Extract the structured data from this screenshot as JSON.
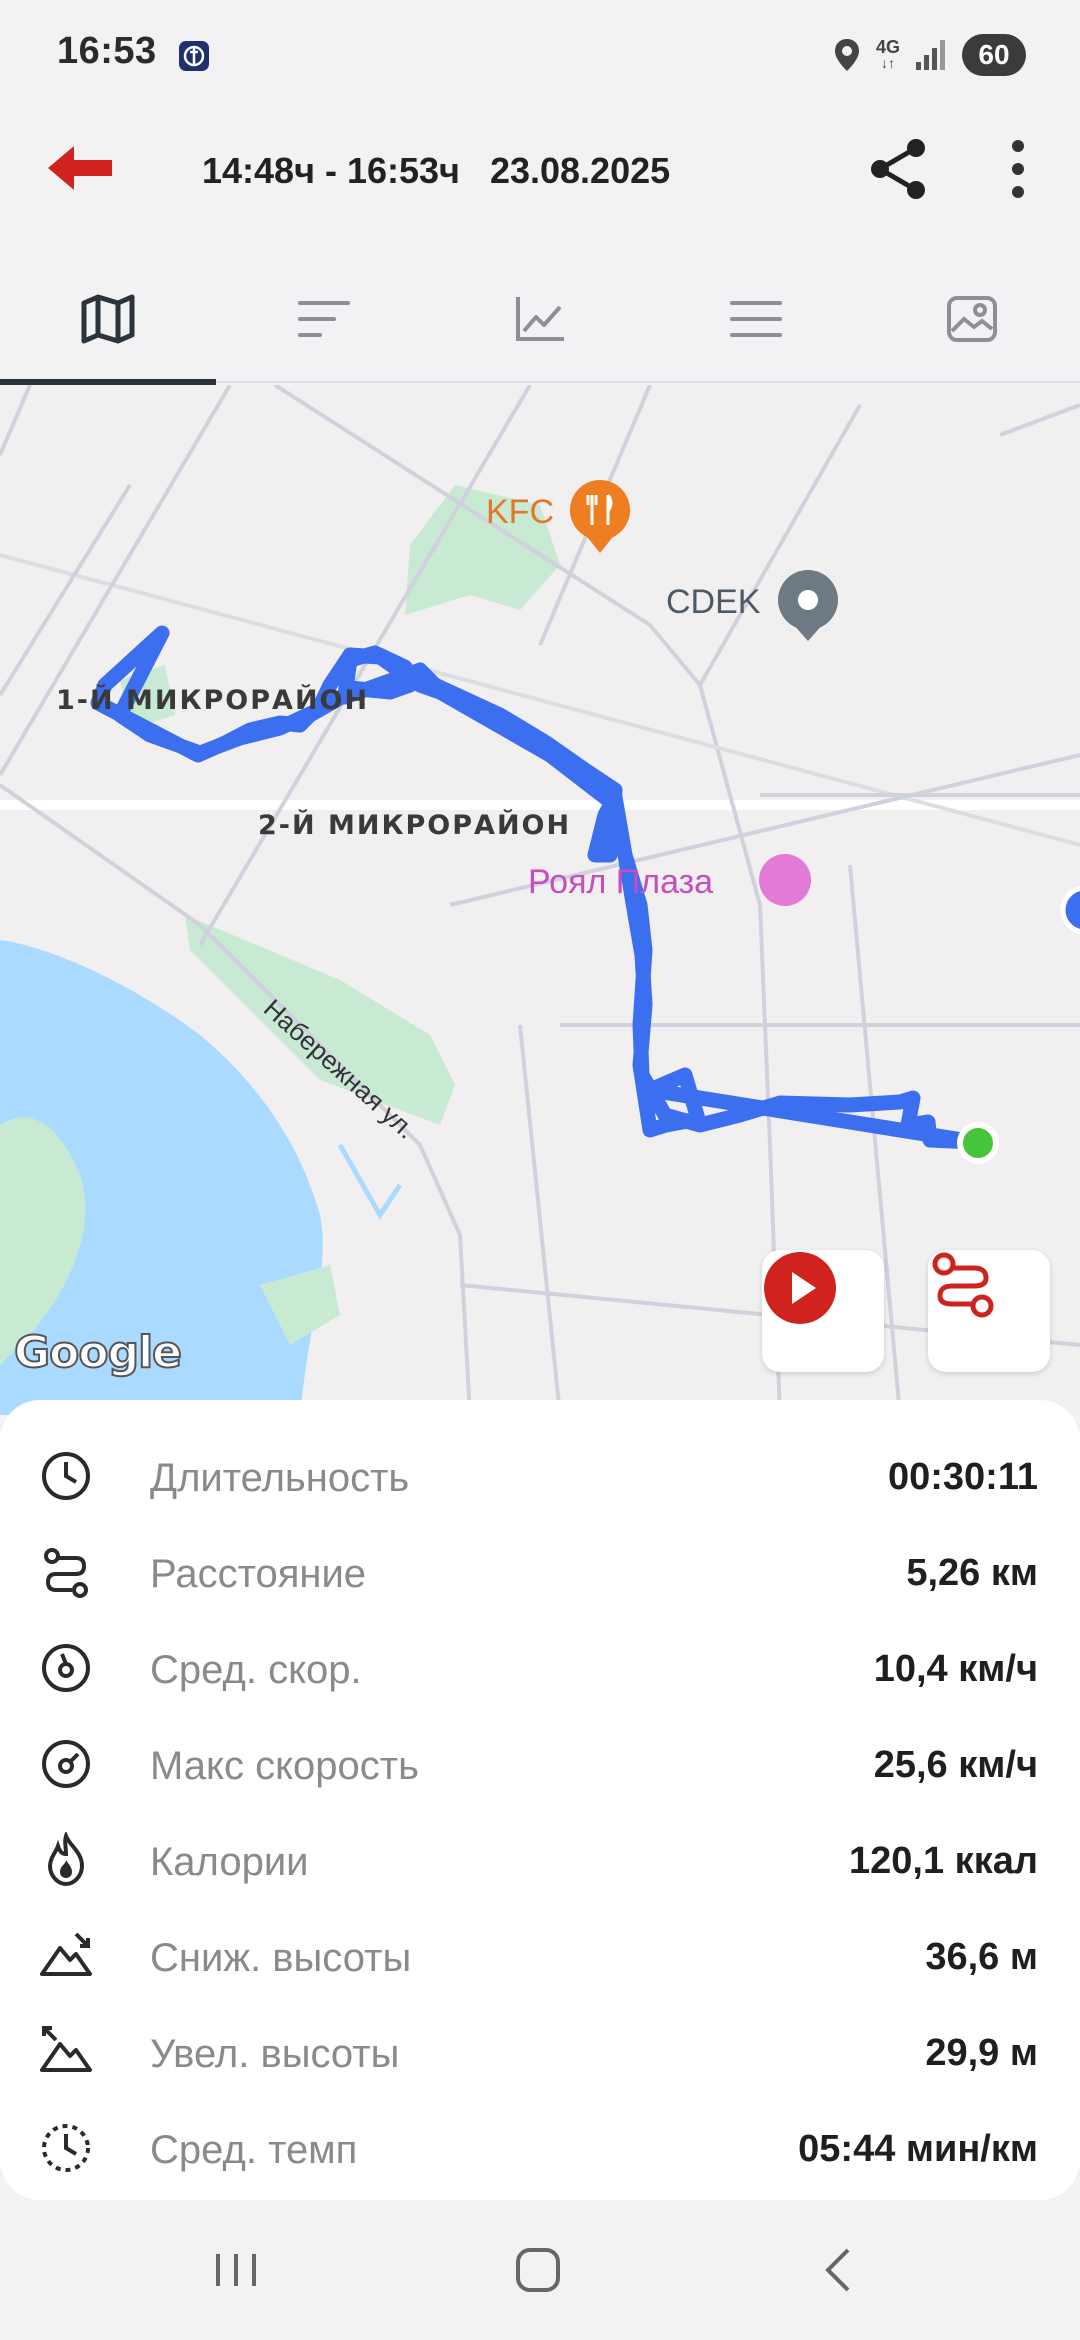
{
  "status_bar": {
    "time": "16:53",
    "network": "4G",
    "battery": "60"
  },
  "header": {
    "time_range": "14:48ч - 16:53ч",
    "date": "23.08.2025"
  },
  "tabs": [
    {
      "icon": "map-icon",
      "active": true
    },
    {
      "icon": "sort-icon",
      "active": false
    },
    {
      "icon": "chart-icon",
      "active": false
    },
    {
      "icon": "list-icon",
      "active": false
    },
    {
      "icon": "photo-icon",
      "active": false
    }
  ],
  "map": {
    "district_1": "1-Й МИКРОРАЙОН",
    "district_2": "2-Й МИКРОРАЙОН",
    "street": "Набережная ул.",
    "poi_kfc": "KFC",
    "poi_cdek": "CDEK",
    "poi_royal": "Роял Плаза",
    "provider": "Google",
    "route_color": "#3b6ff0",
    "end_marker_color": "#46c43a"
  },
  "stats": [
    {
      "icon": "clock-icon",
      "label": "Длительность",
      "value": "00:30:11"
    },
    {
      "icon": "route-icon",
      "label": "Расстояние",
      "value": "5,26 км"
    },
    {
      "icon": "speedometer-icon",
      "label": "Сред. скор.",
      "value": "10,4 км/ч"
    },
    {
      "icon": "max-speed-icon",
      "label": "Макс скорость",
      "value": "25,6 км/ч"
    },
    {
      "icon": "flame-icon",
      "label": "Калории",
      "value": "120,1 ккал"
    },
    {
      "icon": "descent-icon",
      "label": "Сниж. высоты",
      "value": "36,6 м"
    },
    {
      "icon": "ascent-icon",
      "label": "Увел. высоты",
      "value": "29,9 м"
    },
    {
      "icon": "pace-icon",
      "label": "Сред. темп",
      "value": "05:44 мин/км"
    }
  ],
  "colors": {
    "accent_red": "#d0231f",
    "text_dark": "#222222",
    "label_gray": "#8a8a8a"
  }
}
